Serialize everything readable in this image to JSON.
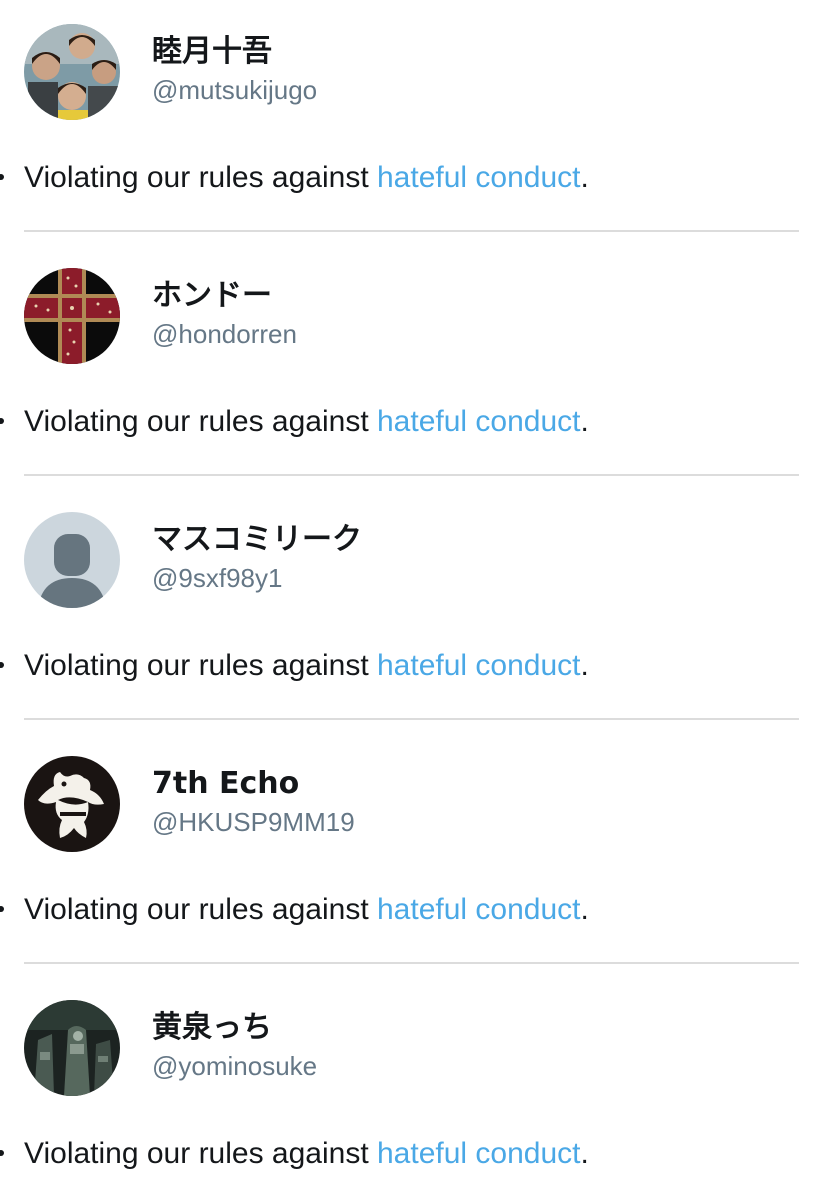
{
  "accounts": [
    {
      "display_name": "睦月十吾",
      "handle": "@mutsukijugo",
      "reason_prefix": "Violating our rules against ",
      "reason_link": "hateful conduct",
      "reason_suffix": ".",
      "avatar_icon": "group-photo-avatar"
    },
    {
      "display_name": "ホンドー",
      "handle": "@hondorren",
      "reason_prefix": "Violating our rules against ",
      "reason_link": "hateful conduct",
      "reason_suffix": ".",
      "avatar_icon": "cross-emblem-avatar"
    },
    {
      "display_name": "マスコミリーク",
      "handle": "@9sxf98y1",
      "reason_prefix": "Violating our rules against ",
      "reason_link": "hateful conduct",
      "reason_suffix": ".",
      "avatar_icon": "default-person-avatar"
    },
    {
      "display_name": "7th Echo",
      "handle": "@HKUSP9MM19",
      "reason_prefix": "Violating our rules against ",
      "reason_link": "hateful conduct",
      "reason_suffix": ".",
      "avatar_icon": "bear-logo-avatar"
    },
    {
      "display_name": "黄泉っち",
      "handle": "@yominosuke",
      "reason_prefix": "Violating our rules against ",
      "reason_link": "hateful conduct",
      "reason_suffix": ".",
      "avatar_icon": "dark-photo-avatar"
    }
  ],
  "colors": {
    "link": "#4aa8e6",
    "handle": "#657786",
    "text": "#14171a",
    "divider": "#dcdcdc"
  }
}
